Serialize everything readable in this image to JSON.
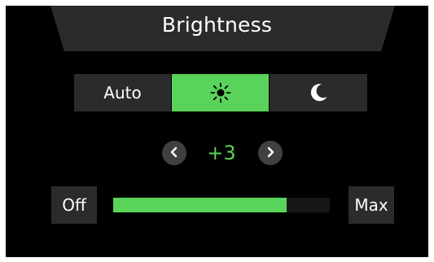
{
  "header": {
    "title": "Brightness"
  },
  "modes": {
    "items": [
      {
        "label": "Auto",
        "kind": "text",
        "active": false
      },
      {
        "label": "",
        "kind": "sun-icon",
        "active": true
      },
      {
        "label": "",
        "kind": "moon-icon",
        "active": false
      }
    ]
  },
  "brightness": {
    "value_label": "+3",
    "level_fraction": 0.8,
    "min_label": "Off",
    "max_label": "Max"
  },
  "colors": {
    "accent": "#5ad35a",
    "panel": "#2b2b2b",
    "background": "#000000",
    "text": "#ffffff"
  }
}
